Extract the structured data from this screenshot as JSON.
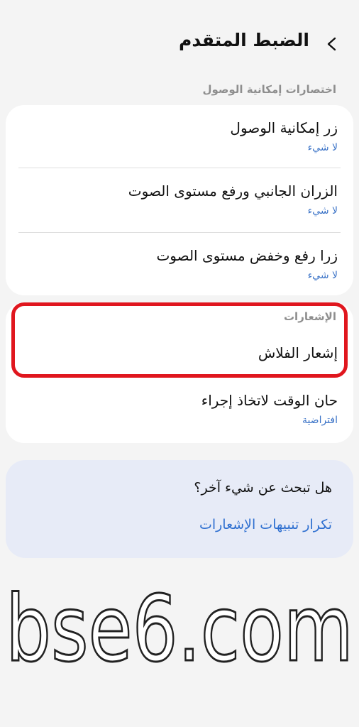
{
  "header": {
    "title": "الضبط المتقدم",
    "back_icon": "chevron-left-icon"
  },
  "sections": {
    "accessibility_shortcuts": "اختصارات إمكانية الوصول",
    "notifications": "الإشعارات"
  },
  "shortcuts": [
    {
      "title": "زر إمكانية الوصول",
      "value": "لا شيء"
    },
    {
      "title": "الزران الجانبي ورفع مستوى الصوت",
      "value": "لا شيء"
    },
    {
      "title": "زرا رفع وخفض مستوى الصوت",
      "value": "لا شيء"
    }
  ],
  "notifications": {
    "flash": {
      "title": "إشعار الفلاش"
    },
    "time_to_act": {
      "title": "حان الوقت لاتخاذ إجراء",
      "value": "افتراضية"
    }
  },
  "suggestion": {
    "question": "هل تبحث عن شيء آخر؟",
    "link": "تكرار تنبيهات الإشعارات"
  },
  "watermark": {
    "text": "bse6.com"
  },
  "colors": {
    "accent": "#3b73c7",
    "highlight": "#e0161e",
    "card": "#ffffff",
    "background": "#f4f4f4"
  }
}
